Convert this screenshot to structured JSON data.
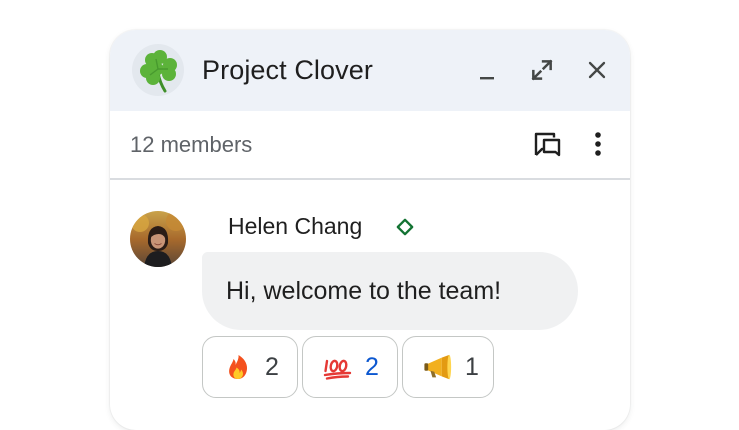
{
  "titlebar": {
    "title": "Project Clover",
    "room_icon": "shamrock-icon",
    "buttons": [
      "minimize-icon",
      "pop-out-icon",
      "close-icon"
    ]
  },
  "subbar": {
    "members": "12 members",
    "buttons": [
      "open-in-threads-icon",
      "more-options-icon"
    ]
  },
  "message": {
    "sender": "Helen Chang",
    "sender_badge": "verified-diamond-icon",
    "text": "Hi, welcome to the team!",
    "reactions": [
      {
        "emoji": "fire-emoji",
        "count": "2"
      },
      {
        "emoji": "hundred-points-emoji",
        "count": "2"
      },
      {
        "emoji": "megaphone-emoji",
        "count": "1"
      }
    ]
  },
  "colors": {
    "titlebar_bg": "#eef2f8",
    "bubble_bg": "#f0f1f2",
    "active_reaction": "#0b57d0",
    "badge_green": "#137333"
  }
}
